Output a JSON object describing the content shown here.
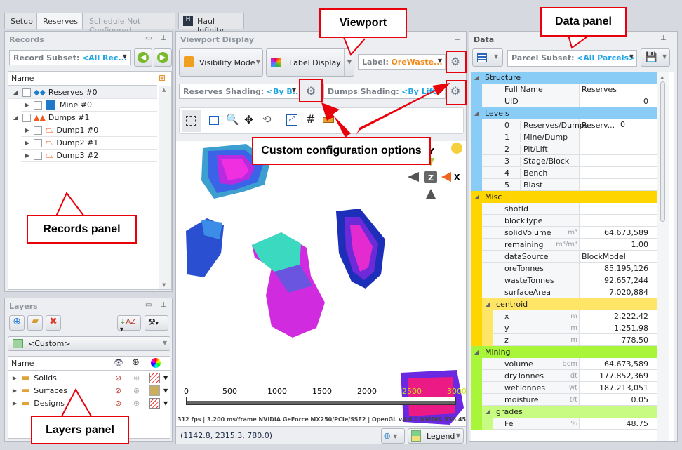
{
  "tabs": [
    {
      "label": "Setup"
    },
    {
      "label": "Reserves"
    },
    {
      "label": "Schedule Not Configured"
    },
    {
      "label": "Haul Infinity"
    }
  ],
  "records": {
    "title": "Records",
    "subset_label": "Record Subset:",
    "subset_value": "<All Rec...",
    "col_name": "Name",
    "items": [
      {
        "label": "Reserves #0"
      },
      {
        "label": "Mine #0"
      },
      {
        "label": "Dumps #1"
      },
      {
        "label": "Dump1 #0"
      },
      {
        "label": "Dump2 #1"
      },
      {
        "label": "Dump3 #2"
      }
    ]
  },
  "layers": {
    "title": "Layers",
    "preset": "<Custom>",
    "col_name": "Name",
    "items": [
      {
        "label": "Solids",
        "color": "hatch"
      },
      {
        "label": "Surfaces",
        "color": "#c8ae5e"
      },
      {
        "label": "Designs",
        "color": "hatch"
      }
    ]
  },
  "viewport": {
    "title": "Viewport Display",
    "visibility_btn": "Visibility Mode",
    "label_display_btn": "Label Display",
    "label_combo_label": "Label:",
    "label_combo_value": "OreWaste...",
    "reserves_shading_label": "Reserves Shading:",
    "reserves_shading_value": "<By B...",
    "dumps_shading_label": "Dumps Shading:",
    "dumps_shading_value": "<By Lift>",
    "axis_labels": {
      "y": "Y",
      "x": "X",
      "z": "Z"
    },
    "scale_ticks": [
      "0",
      "500",
      "1000",
      "1500",
      "2000",
      "2500",
      "3000"
    ],
    "render_info": "312 fps | 3.200 ms/frame NVIDIA GeForce MX250/PCIe/SSE2 | OpenGL v4.6.0 NVIDIA 536.45",
    "coords": "(1142.8, 2315.3, 780.0)",
    "legend_btn": "Legend"
  },
  "data": {
    "title": "Data",
    "subset_label": "Parcel Subset:",
    "subset_value": "<All Parcels>",
    "groups": {
      "structure": {
        "label": "Structure",
        "color": "#89cdf7",
        "rows": [
          {
            "name": "Full Name",
            "value": "Reserves"
          },
          {
            "name": "UID",
            "value": "0"
          }
        ]
      },
      "levels": {
        "label": "Levels",
        "color": "#89cdf7",
        "rows": [
          {
            "idx": "0",
            "name": "Reserves/Dumps",
            "value": "Reserv...",
            "value2": "0"
          },
          {
            "idx": "1",
            "name": "Mine/Dump"
          },
          {
            "idx": "2",
            "name": "Pit/Lift"
          },
          {
            "idx": "3",
            "name": "Stage/Block"
          },
          {
            "idx": "4",
            "name": "Bench"
          },
          {
            "idx": "5",
            "name": "Blast"
          }
        ]
      },
      "misc": {
        "label": "Misc",
        "color": "#ffd500",
        "rows": [
          {
            "name": "shotId",
            "unit": "",
            "value": ""
          },
          {
            "name": "blockType",
            "unit": "",
            "value": ""
          },
          {
            "name": "solidVolume",
            "unit": "m³",
            "value": "64,673,589"
          },
          {
            "name": "remaining",
            "unit": "m³/m³",
            "value": "1.00"
          },
          {
            "name": "dataSource",
            "unit": "",
            "value": "BlockModel"
          },
          {
            "name": "oreTonnes",
            "unit": "",
            "value": "85,195,126"
          },
          {
            "name": "wasteTonnes",
            "unit": "",
            "value": "92,657,244"
          },
          {
            "name": "surfaceArea",
            "unit": "",
            "value": "7,020,884"
          }
        ]
      },
      "centroid": {
        "label": "centroid",
        "color": "#ffe566",
        "rows": [
          {
            "name": "x",
            "unit": "m",
            "value": "2,222.42"
          },
          {
            "name": "y",
            "unit": "m",
            "value": "1,251.98"
          },
          {
            "name": "z",
            "unit": "m",
            "value": "778.50"
          }
        ]
      },
      "mining": {
        "label": "Mining",
        "color": "#a8f53a",
        "rows": [
          {
            "name": "volume",
            "unit": "bcm",
            "value": "64,673,589"
          },
          {
            "name": "dryTonnes",
            "unit": "dt",
            "value": "177,852,369"
          },
          {
            "name": "wetTonnes",
            "unit": "wt",
            "value": "187,213,051"
          },
          {
            "name": "moisture",
            "unit": "t/t",
            "value": "0.05"
          }
        ]
      },
      "grades": {
        "label": "grades",
        "color": "#c8fb82",
        "rows": [
          {
            "name": "Fe",
            "unit": "%",
            "value": "48.75"
          }
        ]
      }
    }
  },
  "callouts": {
    "viewport": "Viewport",
    "data_panel": "Data panel",
    "records_panel": "Records panel",
    "layers_panel": "Layers panel",
    "custom_config": "Custom configuration options"
  }
}
